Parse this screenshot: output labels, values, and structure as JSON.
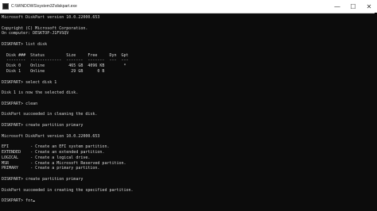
{
  "window": {
    "title": "C:\\WINDOWS\\system32\\diskpart.exe",
    "minimize_glyph": "—",
    "maximize_glyph": "☐",
    "close_glyph": "✕"
  },
  "console": {
    "lines": [
      "Microsoft DiskPart version 10.0.22000.653",
      "",
      "Copyright (C) Microsoft Corporation.",
      "On computer: DESKTOP-J1FVSQV",
      "",
      "DISKPART> list disk",
      "",
      "  Disk ###  Status         Size     Free     Dyn  Gpt",
      "  --------  -------------  -------  -------  ---  ---",
      "  Disk 0    Online          465 GB  4096 KB        *",
      "  Disk 1    Online           29 GB      0 B",
      "",
      "DISKPART> select disk 1",
      "",
      "Disk 1 is now the selected disk.",
      "",
      "DISKPART> clean",
      "",
      "DiskPart succeeded in cleaning the disk.",
      "",
      "DISKPART> create partition primary",
      "",
      "Microsoft DiskPart version 10.0.22000.653",
      "",
      "EFI         - Create an EFI system partition.",
      "EXTENDED    - Create an extended partition.",
      "LOGICAL     - Create a logical drive.",
      "MSR         - Create a Microsoft Reserved partition.",
      "PRIMARY     - Create a primary partition.",
      "",
      "DISKPART> create partition primary",
      "",
      "DiskPart succeeded in creating the specified partition.",
      "",
      "DISKPART> for"
    ]
  },
  "colors": {
    "console_background": "#0c0c0c",
    "console_text": "#d6d6d6",
    "titlebar_background": "#ffffff"
  }
}
